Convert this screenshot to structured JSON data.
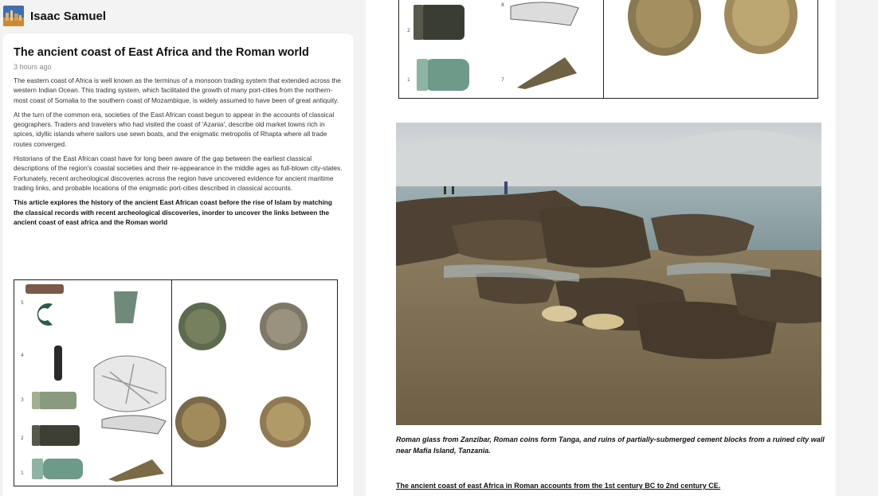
{
  "author": {
    "name": "Isaac Samuel"
  },
  "post": {
    "title": "The ancient coast of East Africa and the Roman world",
    "time": "3 hours ago",
    "paragraphs": [
      "The eastern coast of Africa is well known as the terminus of a monsoon trading system that extended across the western Indian Ocean. This trading system, which facilitated the growth of many port-cities from the northern-most coast of Somalia to the southern coast of Mozambique, is widely assumed to have been of great antiquity.",
      "At the turn of the common era, societies of the East African coast begun to appear in the accounts of classical geographers. Traders and travelers who had visited the coast of 'Azania', describe old market towns rich in spices, idyllic islands where sailors use sewn boats, and the enigmatic metropolis of Rhapta where all trade routes converged.",
      "Historians of the East African coast have for long been aware of the gap between the earliest classical descriptions of the region's coastal societies and their re-appearance in the middle ages as full-blown city-states. Fortunately, recent archeological discoveries across the region have uncovered evidence for ancient maritime trading links, and probable locations of the enigmatic port-cities described in classical accounts."
    ],
    "summary": "This article explores the history of the ancient East African coast before the rise of Islam by matching the classical records with recent archeological discoveries, inorder to uncover the links between the ancient coast of east africa and the Roman world"
  },
  "figures": {
    "caption": "Roman glass from Zanzibar, Roman coins form Tanga, and ruins of partially-submerged cement blocks from a ruined city wall near Mafia Island, Tanzania.",
    "section_link": "The ancient coast of east Africa in Roman accounts from the 1st century BC to 2nd century CE."
  },
  "colors": {
    "accent": "#111111",
    "muted": "#8a8a8a"
  }
}
